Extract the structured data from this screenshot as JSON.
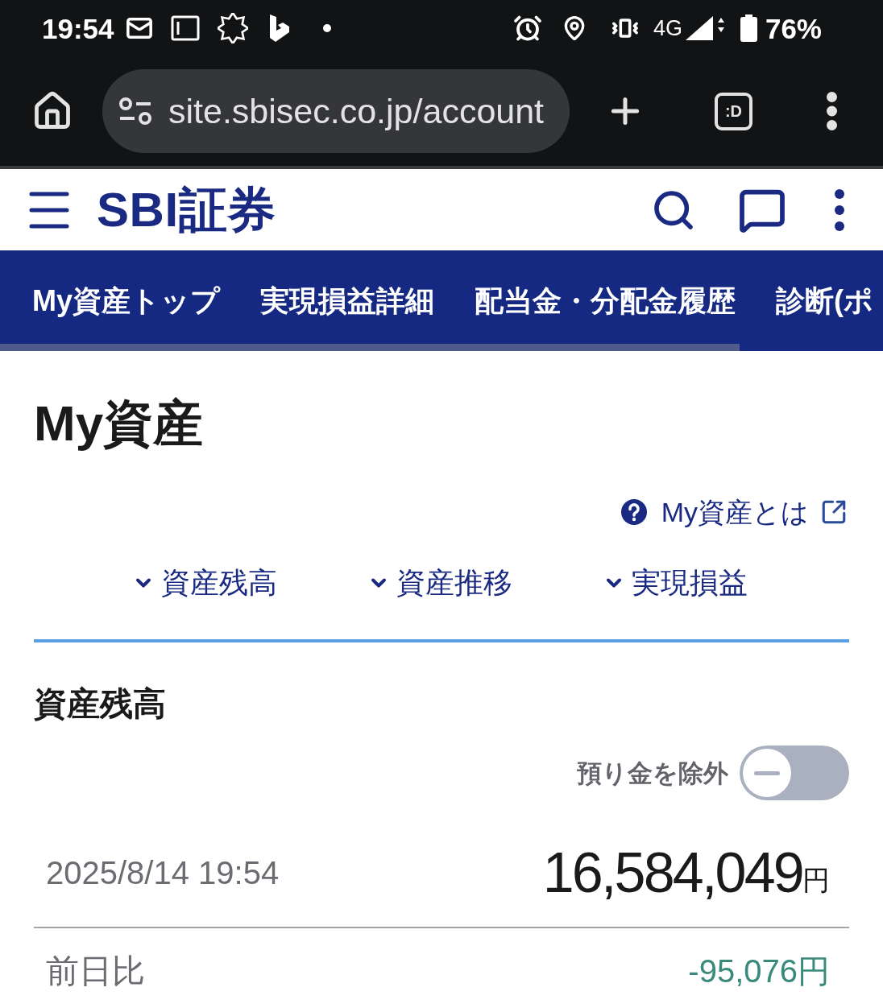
{
  "status_bar": {
    "time": "19:54",
    "network": "4G",
    "battery": "76%"
  },
  "browser": {
    "url": "site.sbisec.co.jp/account",
    "tab_count": ":D"
  },
  "header": {
    "logo": "SBI証券"
  },
  "nav_tabs": [
    {
      "label": "My資産トップ"
    },
    {
      "label": "実現損益詳細"
    },
    {
      "label": "配当金・分配金履歴"
    },
    {
      "label": "診断(ポ"
    }
  ],
  "page": {
    "title": "My資産",
    "help_link": "My資産とは",
    "jump_links": [
      "資産残高",
      "資産推移",
      "実現損益"
    ]
  },
  "balance": {
    "heading": "資産残高",
    "exclude_deposit": {
      "label": "預り金を除外",
      "on": false
    },
    "timestamp": "2025/8/14 19:54",
    "total": "16,584,049",
    "currency": "円",
    "change_label": "前日比",
    "change": "-95,076円"
  }
}
